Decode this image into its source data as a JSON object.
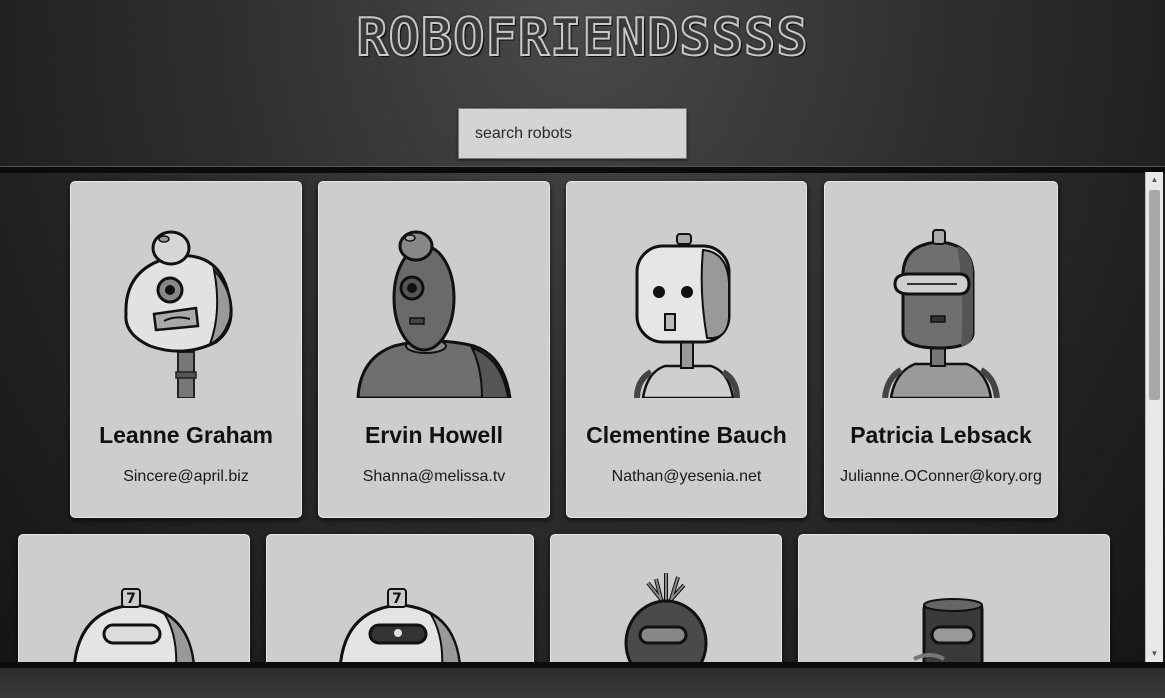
{
  "app": {
    "title": "ROBOFRIENDSSSS"
  },
  "search": {
    "placeholder": "search robots",
    "value": ""
  },
  "robots": [
    {
      "name": "Leanne Graham",
      "email": "Sincere@april.biz"
    },
    {
      "name": "Ervin Howell",
      "email": "Shanna@melissa.tv"
    },
    {
      "name": "Clementine Bauch",
      "email": "Nathan@yesenia.net"
    },
    {
      "name": "Patricia Lebsack",
      "email": "Julianne.OConner@kory.org"
    }
  ],
  "robots_partial": [
    {
      "icon": "robot-avatar-icon"
    },
    {
      "icon": "robot-avatar-icon"
    },
    {
      "icon": "robot-avatar-icon"
    },
    {
      "icon": "robot-avatar-icon"
    }
  ],
  "colors": {
    "background": "#2e2e2e",
    "card": "#cdcdcd",
    "text": "#111111"
  }
}
